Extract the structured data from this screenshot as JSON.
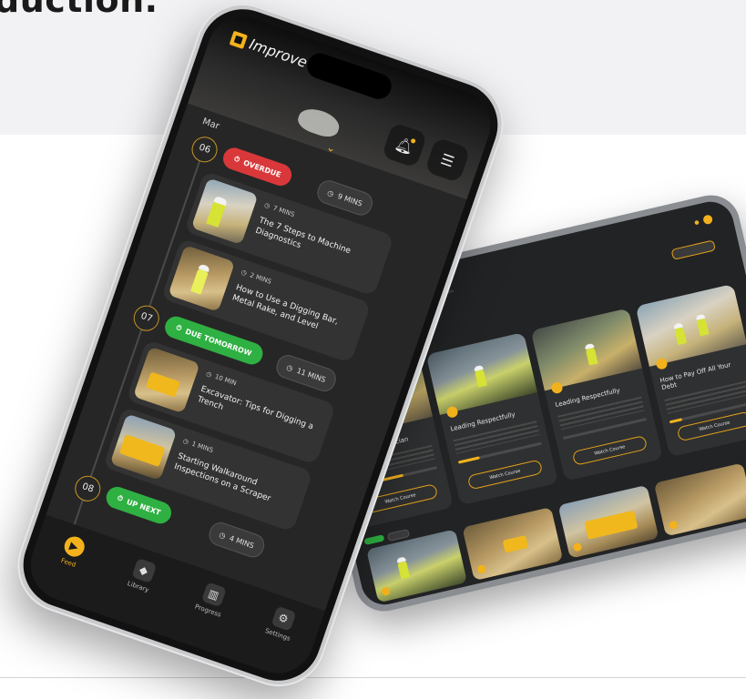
{
  "page": {
    "headline": "duction."
  },
  "phone": {
    "app_name": "Improve",
    "month": "Mar",
    "days": [
      {
        "day": "06",
        "status": "OVERDUE",
        "status_color": "#d9383a",
        "duration": "9 MINS",
        "lessons": [
          {
            "time": "7 MINS",
            "title": "The 7 Steps to Machine Diagnostics"
          },
          {
            "time": "2 MINS",
            "title": "How to Use a Digging Bar, Metal Rake, and Level"
          }
        ]
      },
      {
        "day": "07",
        "status": "DUE TOMORROW",
        "status_color": "#2fb042",
        "duration": "11 MINS",
        "lessons": [
          {
            "time": "10 MIN",
            "title": "Excavator: Tips for Digging a Trench"
          },
          {
            "time": "1 MINS",
            "title": "Starting Walkaround Inspections on a Scraper"
          }
        ]
      },
      {
        "day": "08",
        "status": "UP NEXT",
        "status_color": "#2fb042",
        "duration": "4 MINS"
      }
    ],
    "tabs": [
      {
        "label": "Feed",
        "icon": "feed-icon",
        "active": true
      },
      {
        "label": "Library",
        "icon": "library-icon",
        "active": false
      },
      {
        "label": "Progress",
        "icon": "progress-icon",
        "active": false
      },
      {
        "label": "Settings",
        "icon": "settings-icon",
        "active": false
      }
    ]
  },
  "tablet": {
    "cards": [
      {
        "title": "...to Be a Technician",
        "progress": 0.6
      },
      {
        "title": "Leading Respectfully",
        "progress": 0.25
      },
      {
        "title": "Leading Respectfully",
        "progress": 0.0
      },
      {
        "title": "How to Pay Off All Your Debt",
        "progress": 0.15
      }
    ],
    "watch_label": "Watch Course",
    "accent": "#f3b21b"
  }
}
